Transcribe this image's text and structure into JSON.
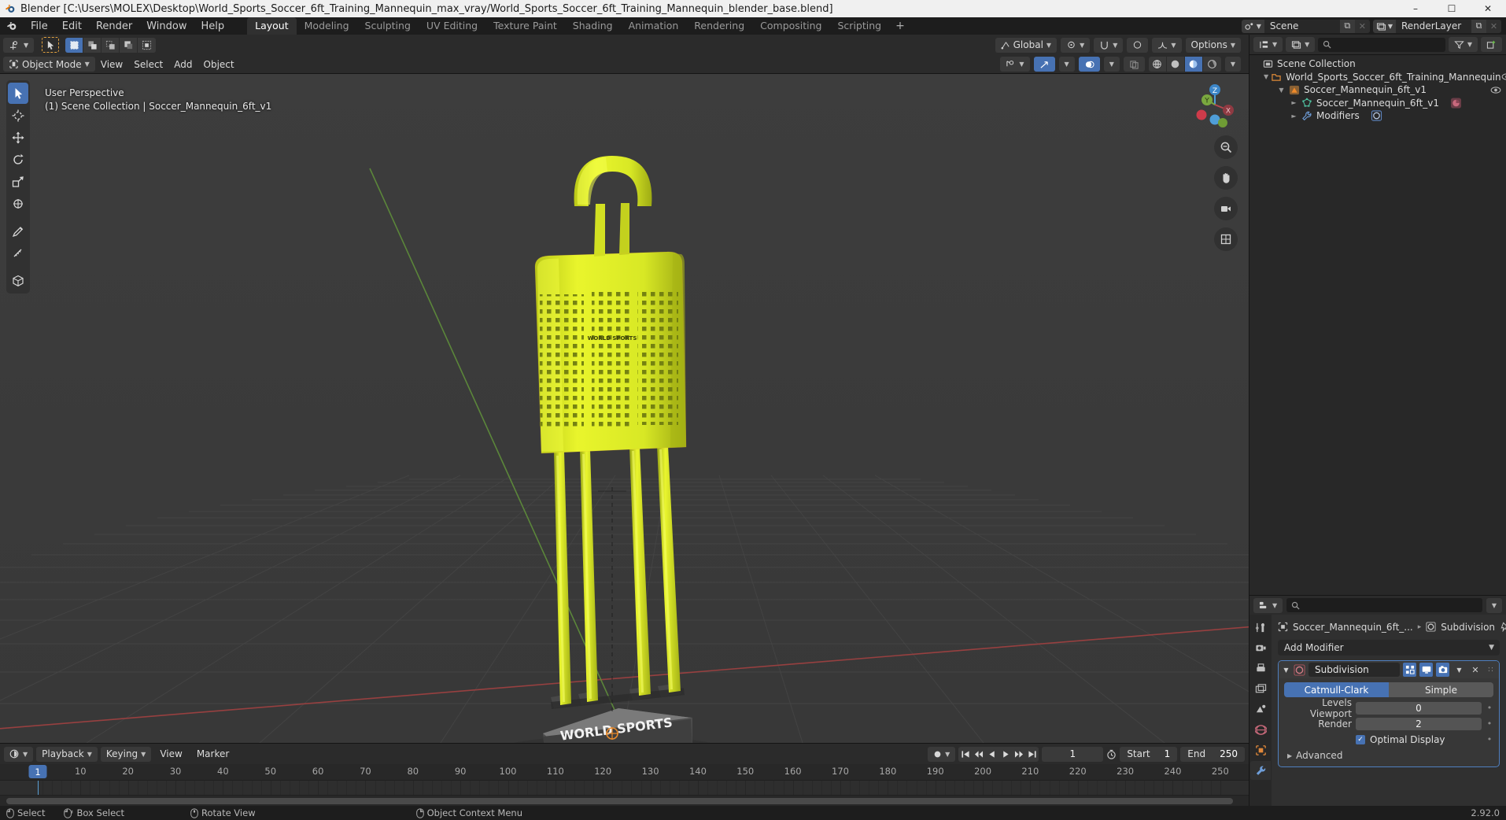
{
  "titlebar": {
    "text": "Blender [C:\\Users\\MOLEX\\Desktop\\World_Sports_Soccer_6ft_Training_Mannequin_max_vray/World_Sports_Soccer_6ft_Training_Mannequin_blender_base.blend]",
    "minimize": "–",
    "maximize": "☐",
    "close": "✕",
    "app_icon": "blender-logo-icon"
  },
  "menus": [
    "File",
    "Edit",
    "Render",
    "Window",
    "Help"
  ],
  "workspaces": {
    "tabs": [
      "Layout",
      "Modeling",
      "Sculpting",
      "UV Editing",
      "Texture Paint",
      "Shading",
      "Animation",
      "Rendering",
      "Compositing",
      "Scripting"
    ],
    "active": "Layout",
    "add_label": "+"
  },
  "topbar_right": {
    "scene_name": "Scene",
    "viewlayer_name": "RenderLayer",
    "new_label": "⧉",
    "unlink_label": "✕"
  },
  "viewport": {
    "mode": "Object Mode",
    "menus": [
      "View",
      "Select",
      "Add",
      "Object"
    ],
    "transform_orientation": "Global",
    "options_label": "Options",
    "overlay_line1": "User Perspective",
    "overlay_line2": "(1) Scene Collection | Soccer_Mannequin_6ft_v1",
    "gizmo_axes": [
      "X",
      "Y",
      "Z"
    ],
    "toolbar_items": [
      "tweak-select-tool",
      "cursor-tool",
      "move-tool",
      "rotate-tool",
      "scale-tool",
      "transform-tool",
      "annotate-tool",
      "measure-tool",
      "add-cube-tool"
    ],
    "nav_icons": [
      "zoom-icon",
      "hand-pan-icon",
      "camera-view-icon",
      "ortho-toggle-icon"
    ]
  },
  "outliner": {
    "search_placeholder": "",
    "display_mode": "view-layer-icon",
    "filter_label": "filter-icon",
    "rows": [
      {
        "label": "Scene Collection",
        "depth": 0,
        "icon": "collection-icon",
        "tri": "",
        "eye": false
      },
      {
        "label": "World_Sports_Soccer_6ft_Training_Mannequin",
        "depth": 1,
        "icon": "collection-group-icon",
        "tri": "▼",
        "eye": true
      },
      {
        "label": "Soccer_Mannequin_6ft_v1",
        "depth": 2,
        "icon": "object-mesh-icon",
        "tri": "▼",
        "eye": true
      },
      {
        "label": "Soccer_Mannequin_6ft_v1",
        "depth": 3,
        "icon": "mesh-data-icon",
        "tri": "►",
        "eye": false,
        "badge": "material-icon"
      },
      {
        "label": "Modifiers",
        "depth": 3,
        "icon": "wrench-icon",
        "tri": "►",
        "eye": false,
        "badge": "subdivision-icon"
      }
    ]
  },
  "properties": {
    "search_placeholder": "",
    "breadcrumb_object": "Soccer_Mannequin_6ft_...",
    "breadcrumb_modifier": "Subdivision",
    "add_modifier_label": "Add Modifier",
    "modifier": {
      "name": "Subdivision",
      "type_icon": "subdivision-icon",
      "display_toggles": [
        "edit-mode-icon",
        "realtime-display-icon",
        "render-display-icon"
      ],
      "extras_label": "⌄",
      "close_label": "✕",
      "drag_label": "∷",
      "subdivision_types": [
        "Catmull-Clark",
        "Simple"
      ],
      "active_type": "Catmull-Clark",
      "levels_viewport_label": "Levels Viewport",
      "levels_viewport_value": "0",
      "render_label": "Render",
      "render_value": "2",
      "optimal_display_label": "Optimal Display",
      "optimal_display_checked": true,
      "advanced_label": "Advanced"
    },
    "tabs": [
      "tool-icon",
      "render-icon",
      "output-icon",
      "view-layer-icon",
      "scene-icon",
      "world-icon",
      "object-icon",
      "modifier-icon"
    ],
    "active_tab": "modifier-icon"
  },
  "timeline": {
    "editor_icon": "timeline-icon",
    "menus": [
      "Playback",
      "Keying",
      "View",
      "Marker"
    ],
    "current_frame": "1",
    "start_label": "Start",
    "start_value": "1",
    "end_label": "End",
    "end_value": "250",
    "ticks": [
      10,
      20,
      30,
      40,
      50,
      60,
      70,
      80,
      90,
      100,
      110,
      120,
      130,
      140,
      150,
      160,
      170,
      180,
      190,
      200,
      210,
      220,
      230,
      240,
      250
    ],
    "playhead_frame": "1"
  },
  "statusbar": {
    "items": [
      {
        "icon": "mouse-left-icon",
        "label": "Select"
      },
      {
        "icon": "mouse-left-drag-icon",
        "label": "Box Select"
      },
      {
        "icon": "mouse-middle-icon",
        "label": "Rotate View"
      },
      {
        "icon": "mouse-right-icon",
        "label": "Object Context Menu"
      }
    ],
    "version": "2.92.0"
  },
  "colors": {
    "accent_blue": "#4772b3",
    "model_yellow": "#e8f028",
    "axis_x_red": "#a63b3b",
    "axis_y_green": "#5a8a3c",
    "bg_viewport": "#3b3b3b"
  }
}
